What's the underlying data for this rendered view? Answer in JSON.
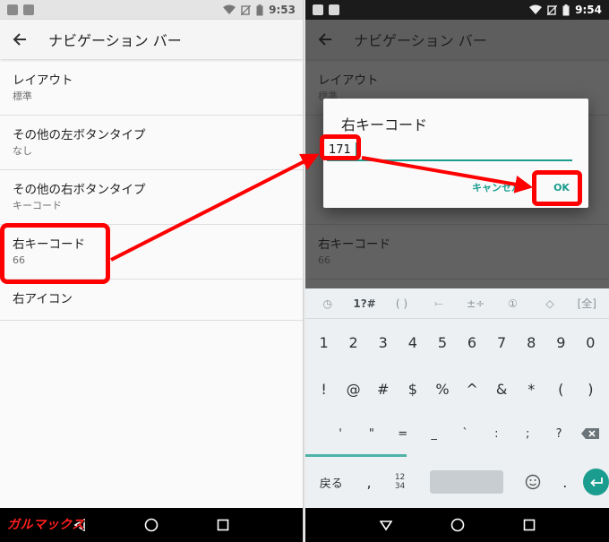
{
  "left_screen": {
    "status": {
      "time": "9:53"
    },
    "toolbar": {
      "title": "ナビゲーション バー"
    },
    "items": [
      {
        "title": "レイアウト",
        "subtitle": "標準"
      },
      {
        "title": "その他の左ボタンタイプ",
        "subtitle": "なし"
      },
      {
        "title": "その他の右ボタンタイプ",
        "subtitle": "キーコード"
      },
      {
        "title": "右キーコード",
        "subtitle": "66"
      },
      {
        "title": "右アイコン",
        "subtitle": ""
      }
    ]
  },
  "right_screen": {
    "status": {
      "time": "9:54"
    },
    "toolbar": {
      "title": "ナビゲーション バー"
    },
    "items": [
      {
        "title": "レイアウト",
        "subtitle": "標準"
      },
      {
        "title": "右キーコード",
        "subtitle": "66"
      }
    ],
    "dialog": {
      "title": "右キーコード",
      "input_value": "171",
      "cancel_label": "キャンセル",
      "ok_label": "OK"
    },
    "keyboard": {
      "top_row": [
        "◷",
        "1?#",
        "( )",
        "⤚",
        "±÷",
        "①",
        "◇",
        "[全]"
      ],
      "row1": [
        "1",
        "2",
        "3",
        "4",
        "5",
        "6",
        "7",
        "8",
        "9",
        "0"
      ],
      "row2": [
        "!",
        "@",
        "#",
        "$",
        "%",
        "^",
        "&",
        "*",
        "(",
        ")"
      ],
      "row3": [
        "'",
        "\"",
        "=",
        "_",
        "`",
        ":",
        ";",
        "?"
      ],
      "bottom": {
        "back_label": "戻る",
        "comma": ",",
        "num_top": "12",
        "num_bottom": "34",
        "period": "."
      }
    }
  },
  "watermark": {
    "logo_text": "ガルマックス"
  },
  "colors": {
    "accent": "#1a9d8f",
    "highlight": "#ff0000"
  }
}
